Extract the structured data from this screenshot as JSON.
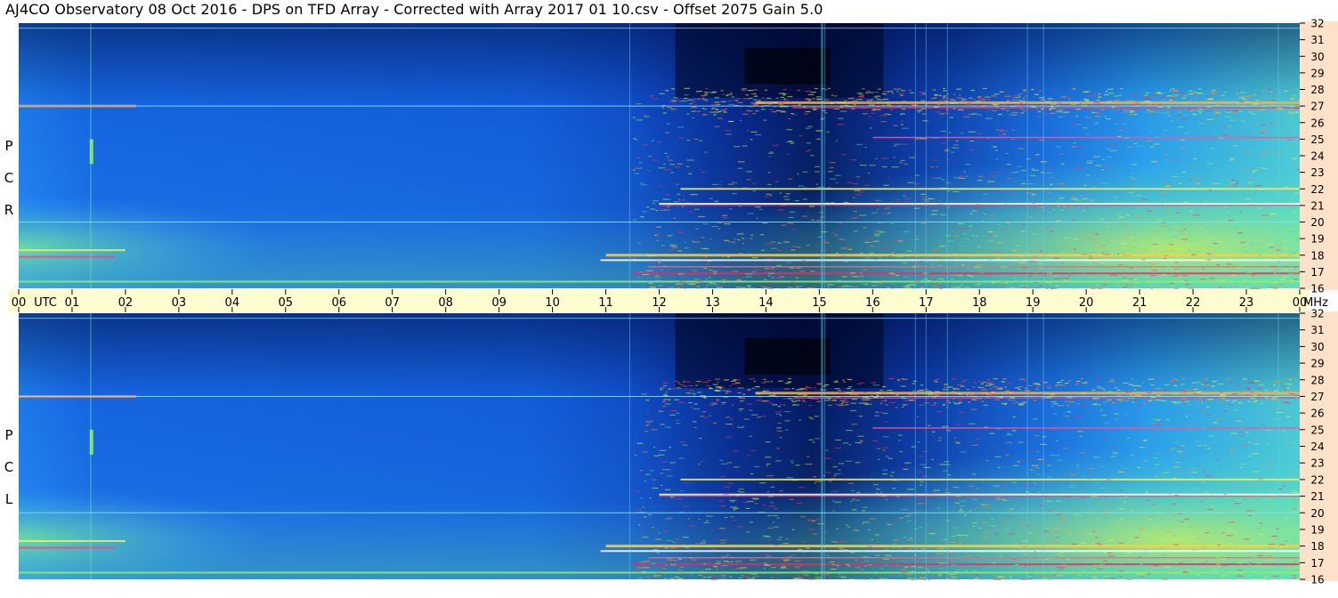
{
  "header": {
    "title": "AJ4CO Observatory  08 Oct 2016  -  DPS on TFD Array  -  Corrected with Array 2017 01 10.csv  -  Offset 2075  Gain 5.0"
  },
  "panels": {
    "rcp_letters": [
      "P",
      "C",
      "R"
    ],
    "lcp_letters": [
      "P",
      "C",
      "L"
    ]
  },
  "colors": {
    "background": "#ffffff",
    "time_axis_bg": "#fffccf",
    "freq_axis_bg": "#fde2c9",
    "grid_lines": "#7fe5f0"
  },
  "chart_data": {
    "type": "heatmap",
    "title": "AJ4CO Observatory  08 Oct 2016  -  DPS on TFD Array  -  Corrected with Array 2017 01 10.csv  -  Offset 2075  Gain 5.0",
    "panels": [
      {
        "name": "RCP",
        "polarization_letters": [
          "R",
          "C",
          "P"
        ]
      },
      {
        "name": "LCP",
        "polarization_letters": [
          "L",
          "C",
          "P"
        ]
      }
    ],
    "x_axis": {
      "unit": "UTC",
      "range": [
        0,
        24
      ],
      "ticks": [
        "00",
        "01",
        "02",
        "03",
        "04",
        "05",
        "06",
        "07",
        "08",
        "09",
        "10",
        "11",
        "12",
        "13",
        "14",
        "15",
        "16",
        "17",
        "18",
        "19",
        "20",
        "21",
        "22",
        "23",
        "00"
      ]
    },
    "y_axis": {
      "unit": "MHz",
      "range": [
        16,
        32
      ],
      "ticks": [
        "16",
        "17",
        "18",
        "19",
        "20",
        "21",
        "22",
        "23",
        "24",
        "25",
        "26",
        "27",
        "28",
        "29",
        "30",
        "31",
        "32"
      ]
    },
    "colormap": [
      "#000b4a",
      "#0030b0",
      "#1565e8",
      "#2aa0f0",
      "#40d8c0",
      "#9cf060",
      "#f0f040",
      "#ff9030",
      "#ff3060",
      "#ffffff"
    ],
    "grid": true
  }
}
